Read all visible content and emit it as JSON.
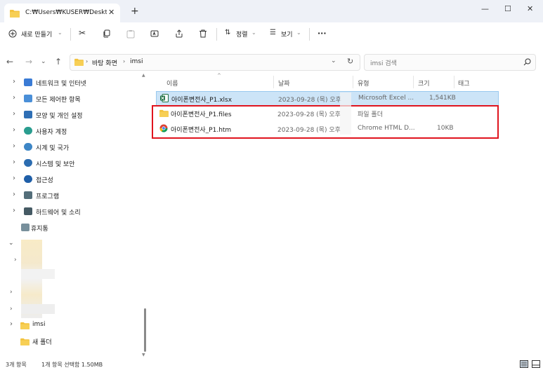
{
  "window": {
    "tab_title": "C:₩Users₩KUSER₩Desktop₩i",
    "new_tab": "+",
    "minimize": "—",
    "maximize": "☐",
    "close": "✕"
  },
  "toolbar": {
    "new_label": "새로 만들기",
    "sort_label": "정렬",
    "view_label": "보기",
    "more_label": "···"
  },
  "address": {
    "crumbs": [
      "바탕 화면",
      "imsi"
    ],
    "search_placeholder": "imsi 검색"
  },
  "sidebar": {
    "items": [
      {
        "label": "네트워크 및 인터넷",
        "color": "#3a7bd5"
      },
      {
        "label": "모든 제어판 항목",
        "color": "#4a8fd8"
      },
      {
        "label": "모양 및 개인 설정",
        "color": "#2f6fb5"
      },
      {
        "label": "사용자 계정",
        "color": "#2a9d8f"
      },
      {
        "label": "시계 및 국가",
        "color": "#3d86c6"
      },
      {
        "label": "시스템 및 보안",
        "color": "#2b6cb0"
      },
      {
        "label": "접근성",
        "color": "#1f5fa8"
      },
      {
        "label": "프로그램",
        "color": "#546e7a"
      },
      {
        "label": "하드웨어 및 소리",
        "color": "#455a64"
      },
      {
        "label": "휴지통",
        "color": "#78909c"
      }
    ],
    "imsi_label": "imsi",
    "new_folder_label": "새 폴더"
  },
  "columns": {
    "name": "이름",
    "date": "날짜",
    "type": "유형",
    "size": "크기",
    "tag": "태그"
  },
  "files": [
    {
      "name": "아이폰변전사_P1.xlsx",
      "date": "2023-09-28 (목) 오후",
      "type": "Microsoft Excel ...",
      "size": "1,541KB",
      "icon": "excel-icon"
    },
    {
      "name": "아이폰변전사_P1.files",
      "date": "2023-09-28 (목) 오후",
      "type": "파일 폴더",
      "size": "",
      "icon": "folder-icon"
    },
    {
      "name": "아이폰변전사_P1.htm",
      "date": "2023-09-28 (목) 오후",
      "type": "Chrome HTML D...",
      "size": "10KB",
      "icon": "chrome-icon"
    }
  ],
  "status": {
    "count": "3개 항목",
    "selection": "1개 항목 선택함 1.50MB"
  },
  "colors": {
    "selection_bg": "#cce4f7",
    "highlight_border": "#e0141e",
    "folder": "#f3c23d"
  }
}
